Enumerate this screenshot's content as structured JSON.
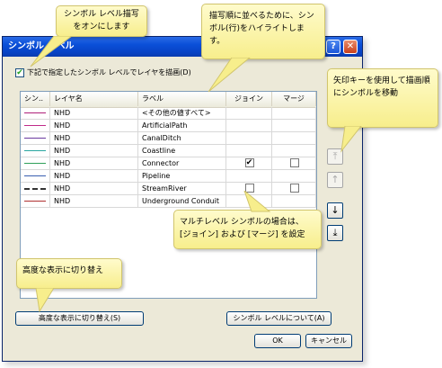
{
  "callouts": {
    "symbol_level_on": "シンボル レベル描写をオンにします",
    "highlight_rows": "描写順に並べるために、シンボル(行)をハイライトします。",
    "arrow_keys": "矢印キーを使用して描画順にシンボルを移動",
    "multilevel_line1": "マルチレベル シンボルの場合は、",
    "multilevel_line2": "[ジョイン] および [マージ] を設定",
    "advanced_view": "高度な表示に切り替え"
  },
  "dialog": {
    "title": "シンボル レベル",
    "help_button": "?",
    "close_button": "✕",
    "checkbox_label": "下記で指定したシンボル レベルでレイヤを描画(D)",
    "checkbox_checked": true
  },
  "table": {
    "columns": [
      "シン..",
      "レイヤ名",
      "ラベル",
      "ジョイン",
      "マージ"
    ],
    "rows": [
      {
        "layer": "NHD",
        "label": "<その他の値すべて>",
        "color": "#b0207a",
        "style": "solid",
        "join": null,
        "merge": null
      },
      {
        "layer": "NHD",
        "label": "ArtificialPath",
        "color": "#c02b8a",
        "style": "solid",
        "join": null,
        "merge": null
      },
      {
        "layer": "NHD",
        "label": "CanalDitch",
        "color": "#6a3aa0",
        "style": "solid",
        "join": null,
        "merge": null
      },
      {
        "layer": "NHD",
        "label": "Coastline",
        "color": "#2aa6a0",
        "style": "solid",
        "join": null,
        "merge": null
      },
      {
        "layer": "NHD",
        "label": "Connector",
        "color": "#2fa05a",
        "style": "solid",
        "join": true,
        "merge": false
      },
      {
        "layer": "NHD",
        "label": "Pipeline",
        "color": "#3a5fb0",
        "style": "solid",
        "join": null,
        "merge": null
      },
      {
        "layer": "NHD",
        "label": "StreamRiver",
        "color": "#333333",
        "style": "dashed",
        "join": false,
        "merge": false
      },
      {
        "layer": "NHD",
        "label": "Underground Conduit",
        "color": "#b03030",
        "style": "solid",
        "join": null,
        "merge": null
      }
    ]
  },
  "side_buttons": {
    "move_top": "⤒",
    "move_up": "↑",
    "move_down": "↓",
    "move_bottom": "⤓"
  },
  "buttons": {
    "advanced": "高度な表示に切り替え(S)",
    "about": "シンボル レベルについて(A)",
    "ok": "OK",
    "cancel": "キャンセル"
  }
}
